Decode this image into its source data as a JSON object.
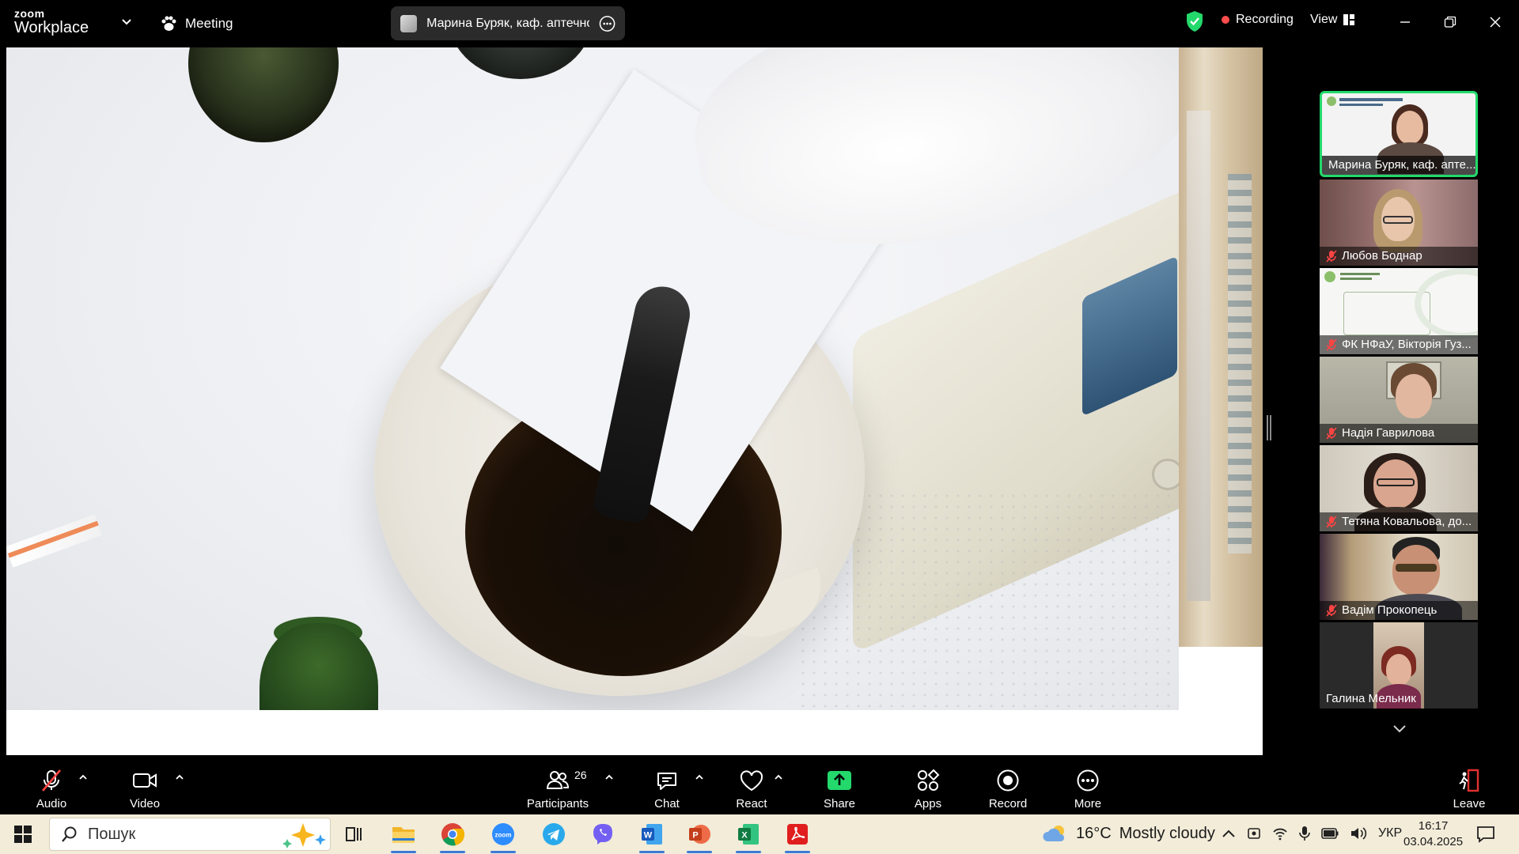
{
  "topbar": {
    "brand_small": "zoom",
    "brand_big": "Workplace",
    "meeting_label": "Meeting",
    "host_pill_name": "Марина Буряк, каф. аптечної те",
    "recording_label": "Recording",
    "view_label": "View",
    "accent_green": "#23d96b",
    "recording_color": "#ff4d4d"
  },
  "shared_screen": {
    "content": "lab-video"
  },
  "gallery": {
    "participants": [
      {
        "name": "Марина Буряк, каф. апте...",
        "active": true,
        "muted": false
      },
      {
        "name": "Любов Боднар",
        "muted": true
      },
      {
        "name": "ФК НФаУ, Вікторія Гуз...",
        "muted": true
      },
      {
        "name": "Надія Гаврилова",
        "muted": true
      },
      {
        "name": "Тетяна Ковальова, до...",
        "muted": true
      },
      {
        "name": "Вадім Прокопець",
        "muted": true
      },
      {
        "name": "Галина Мельник",
        "muted": false
      }
    ]
  },
  "toolbar": {
    "audio": "Audio",
    "video": "Video",
    "participants": "Participants",
    "participants_count": "26",
    "chat": "Chat",
    "react": "React",
    "share": "Share",
    "apps": "Apps",
    "record": "Record",
    "more": "More",
    "leave": "Leave",
    "share_color": "#23d96b",
    "leave_color": "#e0322f"
  },
  "taskbar": {
    "search_placeholder": "Пошук",
    "apps": [
      "task-view-icon",
      "file-explorer-icon",
      "chrome-icon",
      "zoom-icon",
      "telegram-icon",
      "viber-icon",
      "word-icon",
      "powerpoint-icon",
      "excel-icon",
      "acrobat-icon"
    ],
    "weather_temp": "16°C",
    "weather_text": "Mostly cloudy",
    "language": "УКР",
    "time": "16:17",
    "date": "03.04.2025"
  }
}
